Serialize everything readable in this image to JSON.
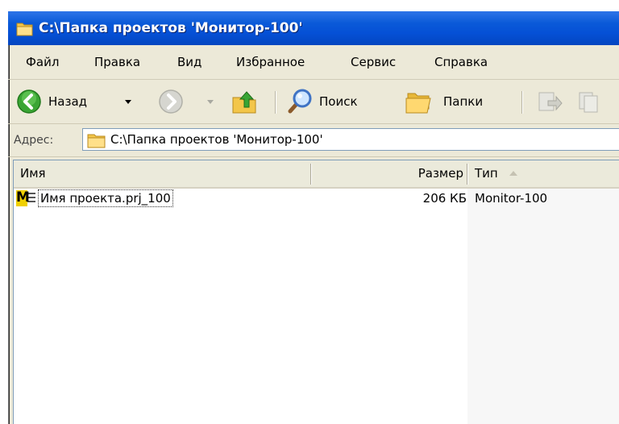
{
  "window": {
    "title": "C:\\Папка проектов 'Монитор-100'"
  },
  "menu": {
    "items": [
      "Файл",
      "Правка",
      "Вид",
      "Избранное",
      "Сервис",
      "Справка"
    ]
  },
  "toolbar": {
    "back_label": "Назад",
    "search_label": "Поиск",
    "folders_label": "Папки"
  },
  "address": {
    "label": "Адрес:",
    "value": "C:\\Папка проектов 'Монитор-100'"
  },
  "list": {
    "columns": [
      "Имя",
      "Размер",
      "Тип"
    ],
    "sort_column": "Тип",
    "rows": [
      {
        "icon": "monitor-100-file-icon",
        "icon_letter": "M",
        "name": "Имя проекта.prj_100",
        "size": "206 КБ",
        "type": "Monitor-100"
      }
    ]
  },
  "colors": {
    "title_bar": "#0a5ad8",
    "window_bg": "#ece9d8",
    "sorted_column": "#f7f7f7",
    "file_icon": "#f0d000"
  }
}
